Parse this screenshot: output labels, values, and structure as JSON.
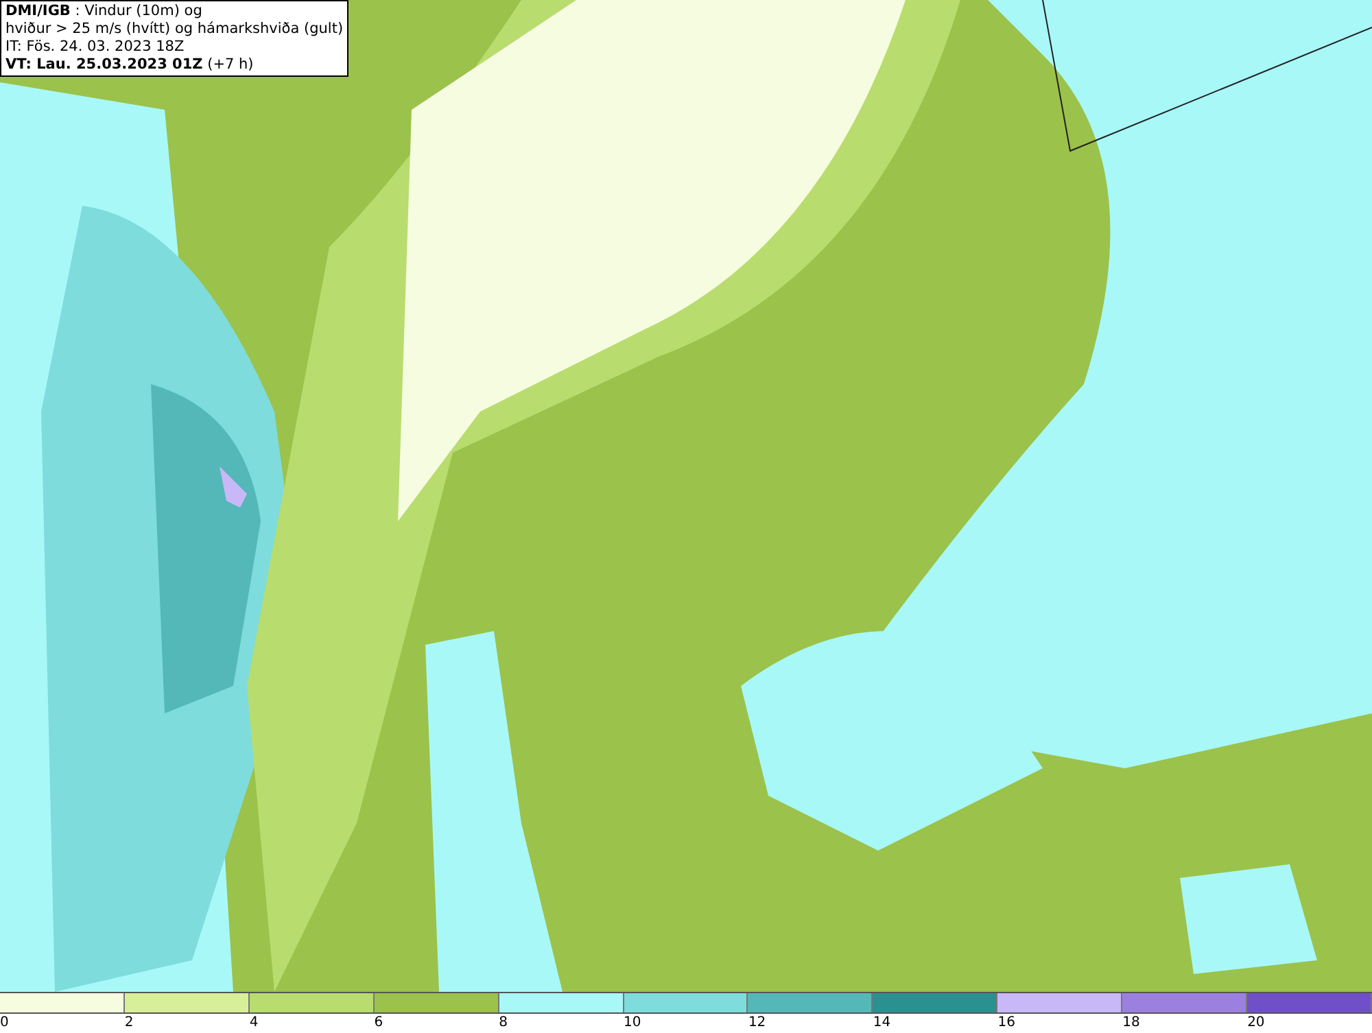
{
  "header": {
    "lines": [
      "**DMI/IGB** : Vindur (10m) og",
      "hviður > 25 m/s (hvítt) og hámarkshviða (gult)",
      "IT: Fös. 24. 03. 2023 18Z",
      "**VT: Lau. 25.03.2023 01Z** (+7 h)"
    ]
  },
  "legend": [
    {
      "label": "0",
      "color": "#f5fce0"
    },
    {
      "label": "2",
      "color": "#d8ef9a"
    },
    {
      "label": "4",
      "color": "#b8dc6e"
    },
    {
      "label": "6",
      "color": "#9bc24a"
    },
    {
      "label": "8",
      "color": "#a8f8f8"
    },
    {
      "label": "10",
      "color": "#7fdcdc"
    },
    {
      "label": "12",
      "color": "#55b8b8"
    },
    {
      "label": "14",
      "color": "#2a9090"
    },
    {
      "label": "16",
      "color": "#c8b8f8"
    },
    {
      "label": "18",
      "color": "#9c80e0"
    },
    {
      "label": "20",
      "color": "#7050c8"
    }
  ]
}
